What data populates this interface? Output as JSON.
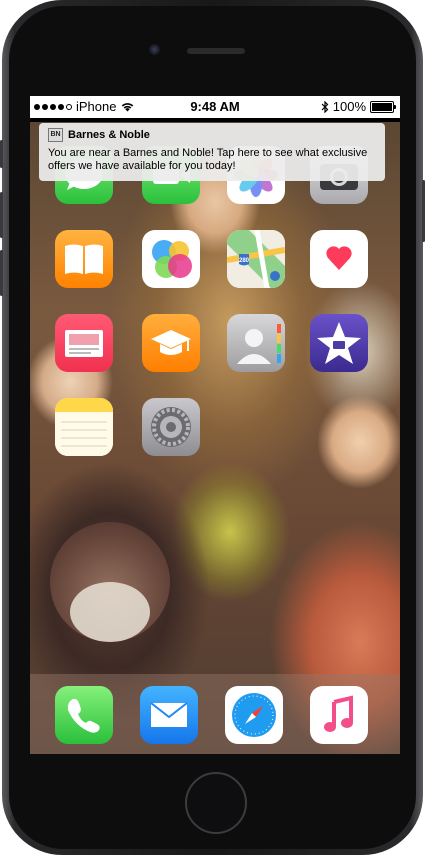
{
  "status_bar": {
    "carrier": "iPhone",
    "time": "9:48 AM",
    "battery": "100%"
  },
  "notification": {
    "app_name": "Barnes & Noble",
    "logo_text": "BN",
    "message": "You are near a Barnes and Noble! Tap here to see what exclusive offers we have available for you today!"
  },
  "home_screen": {
    "apps": [
      {
        "icon": "messages-icon"
      },
      {
        "icon": "facetime-icon"
      },
      {
        "icon": "photos-icon"
      },
      {
        "icon": "camera-icon"
      },
      {
        "icon": "ibooks-icon"
      },
      {
        "icon": "game-center-icon"
      },
      {
        "icon": "maps-icon",
        "label_on_sign": "280"
      },
      {
        "icon": "health-icon"
      },
      {
        "icon": "news-icon"
      },
      {
        "icon": "itunes-u-icon"
      },
      {
        "icon": "contacts-icon"
      },
      {
        "icon": "imovie-icon"
      },
      {
        "icon": "notes-icon"
      },
      {
        "icon": "settings-icon"
      }
    ],
    "dock": [
      {
        "icon": "phone-icon"
      },
      {
        "icon": "mail-icon"
      },
      {
        "icon": "safari-icon"
      },
      {
        "icon": "music-icon"
      }
    ]
  },
  "colors": {
    "messages_green": "#4cd964",
    "ibooks_orange": "#ff9500",
    "news_red": "#fc3158",
    "imovie_purple": "#4e3ba6",
    "mail_blue": "#1e88f7",
    "phone_green": "#4cd964"
  }
}
